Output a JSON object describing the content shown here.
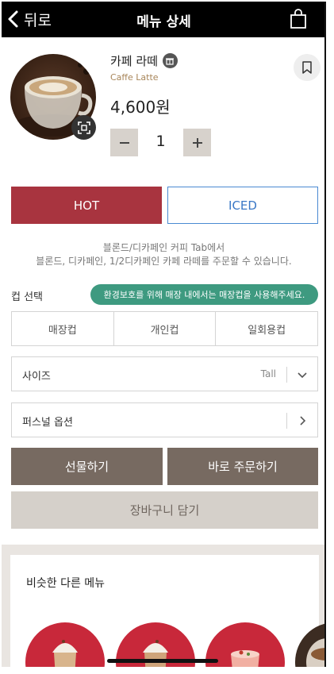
{
  "header": {
    "back_label": "뒤로",
    "title": "메뉴 상세",
    "icons": {
      "back": "chevron-left-icon",
      "bag": "shopping-bag-icon"
    }
  },
  "product": {
    "name_ko": "카페 라떼",
    "name_en": "Caffe Latte",
    "price": "4,600원",
    "quantity": "1",
    "icons": {
      "badge": "cup-badge-icon",
      "zoom": "expand-icon",
      "bookmark": "bookmark-icon"
    }
  },
  "temperature": {
    "hot": "HOT",
    "iced": "ICED",
    "selected": "HOT"
  },
  "notice": {
    "line1": "블론드/디카페인 커피 Tab에서",
    "line2": "블론드, 디카페인, 1/2디카페인 카페 라떼를 주문할 수 있습니다."
  },
  "cup": {
    "label": "컵 선택",
    "eco_message": "환경보호를 위해 매장 내에서는 매장컵을 사용해주세요.",
    "options": [
      "매장컵",
      "개인컵",
      "일회용컵"
    ]
  },
  "size": {
    "label": "사이즈",
    "value": "Tall"
  },
  "personal_option": {
    "label": "퍼스널 옵션"
  },
  "actions": {
    "gift": "선물하기",
    "order_now": "바로 주문하기",
    "add_cart": "장바구니 담기"
  },
  "similar": {
    "title": "비슷한 다른 메뉴"
  },
  "colors": {
    "hot": "#a8343f",
    "iced_border": "#4a8ad2",
    "eco_pill": "#3e9a80",
    "action": "#776a61",
    "cart": "#d5d0ca",
    "english_name": "#a8865a"
  }
}
